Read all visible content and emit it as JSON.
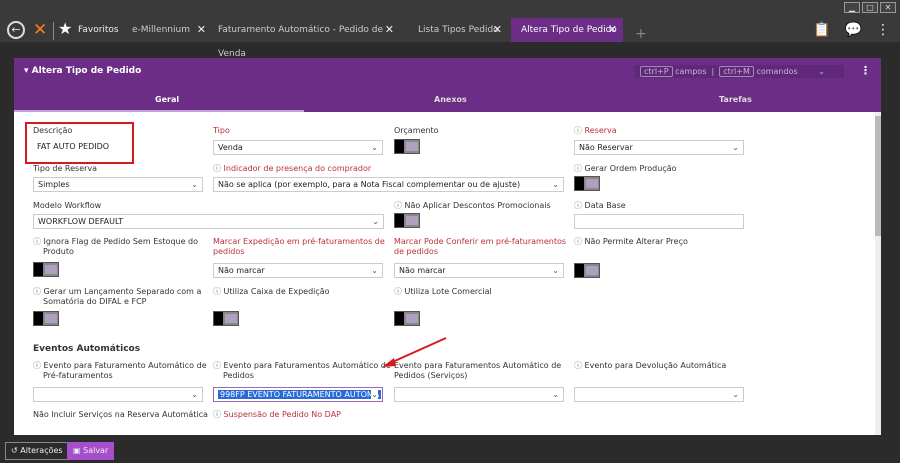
{
  "window_controls": [
    "▁",
    "□",
    "✕"
  ],
  "topbar": {
    "favorites_label": "Favoritos",
    "tabs": [
      {
        "label": "e-Millennium",
        "close": "✕"
      },
      {
        "label": "Faturamento Automático - Pedido de Venda",
        "close": "✕"
      },
      {
        "label": "Lista Tipos Pedido",
        "close": "✕"
      },
      {
        "label": "Altera Tipo de Pedido",
        "close": "✕"
      }
    ],
    "add_tab": "+"
  },
  "panel": {
    "title": "Altera Tipo de Pedido",
    "shortcut_fields_key": "ctrl+P",
    "shortcut_fields_label": "campos",
    "shortcut_commands_key": "ctrl+M",
    "shortcut_commands_label": "comandos",
    "tabs": [
      "Geral",
      "Anexos",
      "Tarefas"
    ]
  },
  "form": {
    "descricao": {
      "label": "Descrição",
      "value": "FAT AUTO PEDIDO"
    },
    "tipo": {
      "label": "Tipo",
      "value": "Venda"
    },
    "orcamento": {
      "label": "Orçamento"
    },
    "reserva": {
      "label": "Reserva",
      "value": "Não Reservar"
    },
    "tipo_reserva": {
      "label": "Tipo de Reserva",
      "value": "Simples"
    },
    "indicador": {
      "label": "Indicador de presença do comprador",
      "value": "Não se aplica (por exemplo, para a Nota Fiscal complementar ou de ajuste)"
    },
    "gerar_ordem": {
      "label": "Gerar Ordem Produção"
    },
    "modelo_workflow": {
      "label": "Modelo Workflow",
      "value": "WORKFLOW DEFAULT"
    },
    "nao_aplicar": {
      "label": "Não Aplicar Descontos Promocionais"
    },
    "data_base": {
      "label": "Data Base"
    },
    "ignora_flag": {
      "label_1": "Ignora Flag de Pedido Sem Estoque do",
      "label_2": "Produto"
    },
    "marcar_expedicao": {
      "label_1": "Marcar Expedição em pré-faturamentos de",
      "label_2": "pedidos",
      "value": "Não marcar"
    },
    "marcar_conferir": {
      "label_1": "Marcar Pode Conferir em pré-faturamentos",
      "label_2": "de pedidos",
      "value": "Não marcar"
    },
    "nao_permite": {
      "label": "Não Permite Alterar Preço"
    },
    "gerar_lancamento": {
      "label_1": "Gerar um Lançamento Separado com a",
      "label_2": "Somatória do DIFAL e FCP"
    },
    "utiliza_caixa": {
      "label": "Utiliza Caixa de Expedição"
    },
    "utiliza_lote": {
      "label": "Utiliza Lote Comercial"
    },
    "eventos_header": "Eventos Automáticos",
    "evento_pre": {
      "label_1": "Evento para Faturamento Automático de",
      "label_2": "Pré-faturamentos"
    },
    "evento_pedidos": {
      "label_1": "Evento para Faturamentos Automático de",
      "label_2": "Pedidos",
      "value": "998FP EVENTO FATURAMENTO AUTOMÁ"
    },
    "evento_servicos": {
      "label_1": "Evento para Faturamentos Automático de",
      "label_2": "Pedidos (Serviços)"
    },
    "evento_devolucao": {
      "label": "Evento para Devolução Automática"
    },
    "nao_incluir": {
      "label": "Não Incluir Serviços na Reserva Automática"
    },
    "suspensao": {
      "label": "Suspensão de Pedido No DAP"
    }
  },
  "bottombar": {
    "alteracoes": "Alterações",
    "salvar": "Salvar"
  }
}
